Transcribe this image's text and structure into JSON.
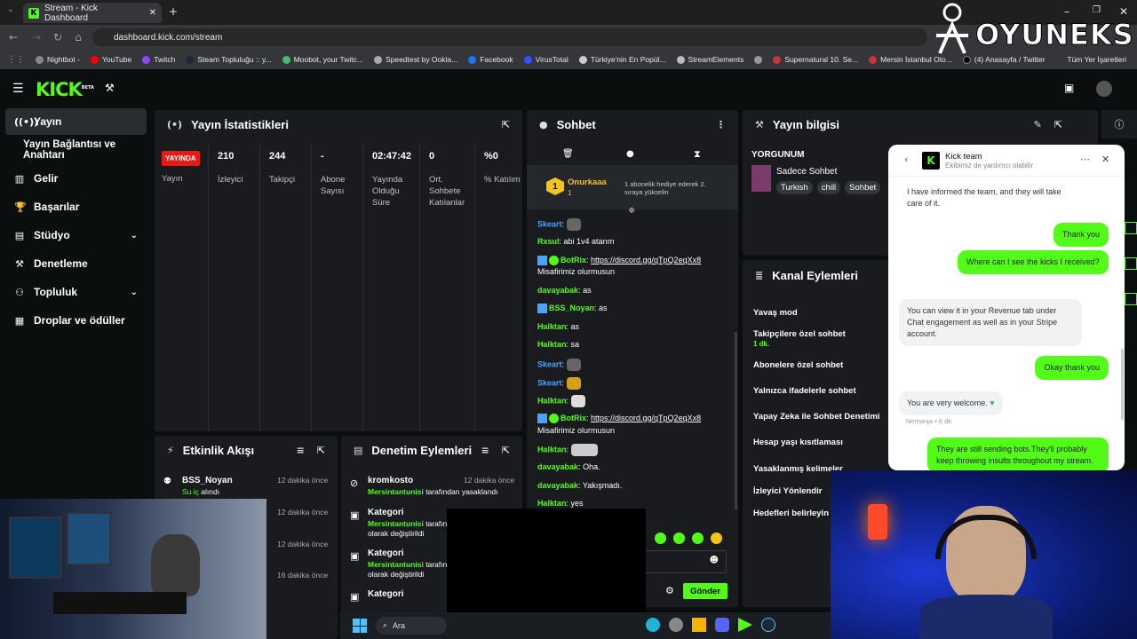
{
  "browser": {
    "tab_title": "Stream - Kick Dashboard",
    "url": "dashboard.kick.com/stream",
    "bookmarks": [
      "Nightbot -",
      "YouTube",
      "Twitch",
      "Steam Topluluğu :: y...",
      "Moobot, your Twitc...",
      "Speedtest by Ookla...",
      "Facebook",
      "VirusTotal",
      "Türkiye'nin En Popül...",
      "StreamElements",
      "",
      "Supernatural 10. Se...",
      "Mersin İstanbul Oto...",
      "(4) Anasayfa / Twitter"
    ],
    "all_bookmarks": "Tüm Yer İşaretleri"
  },
  "brand": {
    "logo": "KICK",
    "beta": "BETA",
    "watermark": "OYUNEKS"
  },
  "colors": {
    "accent": "#53fc18",
    "live": "#e91916",
    "panel": "#191b1f",
    "bg": "#0b0e0f"
  },
  "sidebar": {
    "items": [
      {
        "label": "Yayın",
        "icon": "broadcast-icon"
      },
      {
        "label": "Yayın Bağlantısı ve Anahtarı",
        "icon": ""
      },
      {
        "label": "Gelir",
        "icon": "chart-icon"
      },
      {
        "label": "Başarılar",
        "icon": "trophy-icon"
      },
      {
        "label": "Stüdyo",
        "icon": "studio-icon"
      },
      {
        "label": "Denetleme",
        "icon": "hammer-icon"
      },
      {
        "label": "Topluluk",
        "icon": "community-icon"
      },
      {
        "label": "Droplar ve ödüller",
        "icon": "gift-icon"
      }
    ]
  },
  "stats": {
    "title": "Yayın İstatistikleri",
    "live_badge": "YAYINDA",
    "stream_label": "Yayın",
    "columns": [
      {
        "value": "210",
        "label": "İzleyici"
      },
      {
        "value": "244",
        "label": "Takipçi"
      },
      {
        "value": "-",
        "label": "Abone Sayısı"
      },
      {
        "value": "02:47:42",
        "label": "Yayında Olduğu Süre"
      },
      {
        "value": "0",
        "label": "Ort. Sohbete Katılanlar"
      },
      {
        "value": "%0",
        "label": "% Katılım"
      }
    ]
  },
  "activity": {
    "title": "Etkinlik Akışı",
    "items": [
      {
        "user": "BSS_Noyan",
        "action": "Su iç",
        "suffix": "alındı",
        "time": "12 dakika önce"
      },
      {
        "user": "",
        "action": "",
        "suffix": "",
        "time": "12 dakika önce"
      },
      {
        "user": "",
        "action": "",
        "suffix": "",
        "time": "12 dakika önce"
      },
      {
        "user": "",
        "action": "",
        "suffix": "",
        "time": "16 dakika önce"
      }
    ]
  },
  "moderation": {
    "title": "Denetim Eylemleri",
    "items": [
      {
        "title": "kromkosto",
        "user": "Mersintantunisi",
        "text": "tarafından yasaklandı",
        "time": "12 dakika önce"
      },
      {
        "title": "Kategori",
        "user": "Mersintantunisi",
        "text": "tarafından",
        "text2": "olarak değiştirildi"
      },
      {
        "title": "Kategori",
        "user": "Mersintantunisi",
        "text": "tarafından",
        "text2": "olarak değiştirildi"
      },
      {
        "title": "Kategori",
        "user": "",
        "text": "",
        "text2": ""
      }
    ]
  },
  "chat": {
    "title": "Sohbet",
    "pinned_user": "Onurkaaa",
    "pinned_count": "1",
    "pinned_text": "1 abonelik hediye ederek 2. sıraya yükselin",
    "send_label": "Gönder",
    "messages": [
      {
        "user": "Skeart",
        "text": "",
        "color": "b"
      },
      {
        "user": "Rxsul",
        "text": "abi 1v4 atarım",
        "color": "g"
      },
      {
        "user": "BotRix",
        "text": "https://discord.gg/qTpQ2eqXx8",
        "text2": "Misafirimiz olurmusun",
        "color": "g"
      },
      {
        "user": "davayabak",
        "text": "as",
        "color": "g"
      },
      {
        "user": "BSS_Noyan",
        "text": "as",
        "color": "g"
      },
      {
        "user": "Halktan",
        "text": "as",
        "color": "g"
      },
      {
        "user": "Halktan",
        "text": "sa",
        "color": "g"
      },
      {
        "user": "Skeart",
        "text": "",
        "color": "b"
      },
      {
        "user": "Skeart",
        "text": "",
        "color": "b"
      },
      {
        "user": "Halktan",
        "text": "",
        "color": "g"
      },
      {
        "user": "BotRix",
        "text": "https://discord.gg/qTpQ2eqXx8",
        "text2": "Misafirimiz olurmusun",
        "color": "g"
      },
      {
        "user": "Halktan",
        "text": "",
        "color": "g"
      },
      {
        "user": "davayabak",
        "text": "Oha.",
        "color": "g"
      },
      {
        "user": "davayabak",
        "text": "Yakışmadı.",
        "color": "g"
      },
      {
        "user": "Halktan",
        "text": "yes",
        "color": "g"
      }
    ]
  },
  "stream_info": {
    "title": "Yayın bilgisi",
    "stream_title": "YORGUNUM",
    "category": "Sadece Sohbet",
    "tags": [
      "Turkish",
      "chill",
      "Sohbet"
    ]
  },
  "channel_actions": {
    "title": "Kanal Eylemleri",
    "items": [
      "Yavaş mod",
      "Takipçilere özel sohbet",
      "Abonelere özel sohbet",
      "Yalnızca ifadelerle sohbet",
      "Yapay Zeka ile Sohbet Denetimi",
      "Hesap yaşı kısıtlaması",
      "Yasaklanmış kelimeler",
      "İzleyici Yönlendir",
      "Hedefleri belirleyin"
    ],
    "follower_sub": "1 dk."
  },
  "support": {
    "name": "Kick team",
    "subtitle": "Ekibimiz de yardımcı olabilir",
    "messages": [
      {
        "side": "L",
        "text": "I have informed the team, and they will take care of it."
      },
      {
        "side": "R",
        "text": "Thank you"
      },
      {
        "side": "R",
        "text": "Where can I see the kicks I received?"
      },
      {
        "side": "L",
        "text": "You can view it in your Revenue tab under Chat engagement as well as in your Stripe account."
      },
      {
        "side": "R",
        "text": "Okay thank you"
      },
      {
        "side": "L",
        "text": "You are very welcome."
      },
      {
        "side": "R",
        "text": "They are still sending bots.They'll probably keep throwing insults throughout my stream."
      }
    ],
    "meta": "Nemanja • 6 dk"
  },
  "taskbar": {
    "search": "Ara"
  }
}
